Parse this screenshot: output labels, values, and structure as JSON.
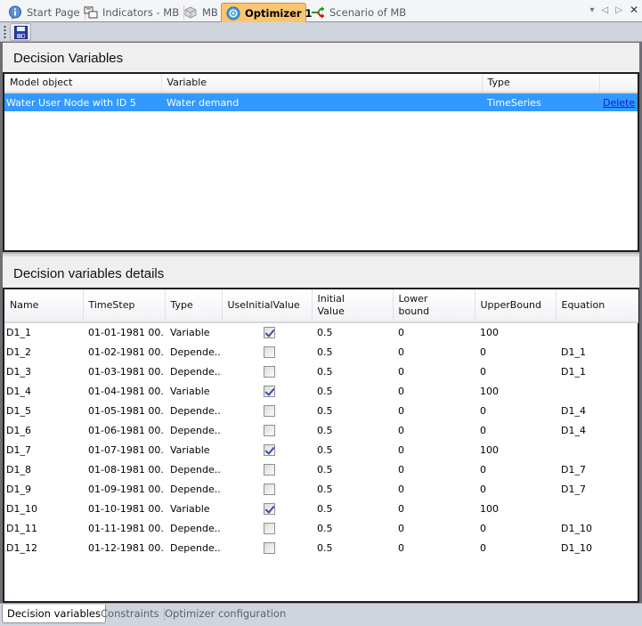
{
  "doc_tabs": [
    {
      "label": "Start Page",
      "icon": "info-icon",
      "active": false
    },
    {
      "label": "Indicators - MB",
      "icon": "indicators-icon",
      "active": false
    },
    {
      "label": "MB",
      "icon": "model-box-icon",
      "active": false
    },
    {
      "label": "Optimizer 1",
      "icon": "optimizer-target-icon",
      "active": true
    },
    {
      "label": "Scenario of MB",
      "icon": "scenario-arrows-icon",
      "active": false
    }
  ],
  "strip_controls": {
    "dropdown": "▾",
    "prev": "◁",
    "next": "▷",
    "close": "✕"
  },
  "toolbar": {
    "save_icon": "save-disk-icon"
  },
  "decision_variables": {
    "title": "Decision Variables",
    "columns": [
      "Model object",
      "Variable",
      "",
      "Type",
      ""
    ],
    "rows": [
      {
        "model_object": "Water User Node with ID 5",
        "variable": "Water demand",
        "type": "TimeSeries",
        "action": "Delete",
        "selected": true
      }
    ]
  },
  "details": {
    "title": "Decision variables details",
    "columns": [
      "Name",
      "TimeStep",
      "Type",
      "UseInitialValue",
      "Initial\nValue",
      "Lower\nbound",
      "UpperBound",
      "Equation"
    ],
    "rows": [
      {
        "name": "D1_1",
        "timestep": "01-01-1981 00...",
        "type": "Variable",
        "use_initial": true,
        "initial": "0.5",
        "lower": "0",
        "upper": "100",
        "equation": ""
      },
      {
        "name": "D1_2",
        "timestep": "01-02-1981 00...",
        "type": "Depende...",
        "use_initial": false,
        "initial": "0.5",
        "lower": "0",
        "upper": "0",
        "equation": "D1_1"
      },
      {
        "name": "D1_3",
        "timestep": "01-03-1981 00...",
        "type": "Depende...",
        "use_initial": false,
        "initial": "0.5",
        "lower": "0",
        "upper": "0",
        "equation": "D1_1"
      },
      {
        "name": "D1_4",
        "timestep": "01-04-1981 00...",
        "type": "Variable",
        "use_initial": true,
        "initial": "0.5",
        "lower": "0",
        "upper": "100",
        "equation": ""
      },
      {
        "name": "D1_5",
        "timestep": "01-05-1981 00...",
        "type": "Depende...",
        "use_initial": false,
        "initial": "0.5",
        "lower": "0",
        "upper": "0",
        "equation": "D1_4"
      },
      {
        "name": "D1_6",
        "timestep": "01-06-1981 00...",
        "type": "Depende...",
        "use_initial": false,
        "initial": "0.5",
        "lower": "0",
        "upper": "0",
        "equation": "D1_4"
      },
      {
        "name": "D1_7",
        "timestep": "01-07-1981 00...",
        "type": "Variable",
        "use_initial": true,
        "initial": "0.5",
        "lower": "0",
        "upper": "100",
        "equation": ""
      },
      {
        "name": "D1_8",
        "timestep": "01-08-1981 00...",
        "type": "Depende...",
        "use_initial": false,
        "initial": "0.5",
        "lower": "0",
        "upper": "0",
        "equation": "D1_7"
      },
      {
        "name": "D1_9",
        "timestep": "01-09-1981 00...",
        "type": "Depende...",
        "use_initial": false,
        "initial": "0.5",
        "lower": "0",
        "upper": "0",
        "equation": "D1_7"
      },
      {
        "name": "D1_10",
        "timestep": "01-10-1981 00...",
        "type": "Variable",
        "use_initial": true,
        "initial": "0.5",
        "lower": "0",
        "upper": "100",
        "equation": ""
      },
      {
        "name": "D1_11",
        "timestep": "01-11-1981 00...",
        "type": "Depende...",
        "use_initial": false,
        "initial": "0.5",
        "lower": "0",
        "upper": "0",
        "equation": "D1_10"
      },
      {
        "name": "D1_12",
        "timestep": "01-12-1981 00...",
        "type": "Depende...",
        "use_initial": false,
        "initial": "0.5",
        "lower": "0",
        "upper": "0",
        "equation": "D1_10"
      }
    ]
  },
  "bottom_tabs": [
    {
      "label": "Decision variables",
      "active": true
    },
    {
      "label": "Constraints",
      "active": false
    },
    {
      "label": "Optimizer configuration",
      "active": false
    }
  ],
  "colors": {
    "selection": "#3399ff",
    "active_tab": "#fbc56f",
    "link": "#0a1fd8"
  }
}
